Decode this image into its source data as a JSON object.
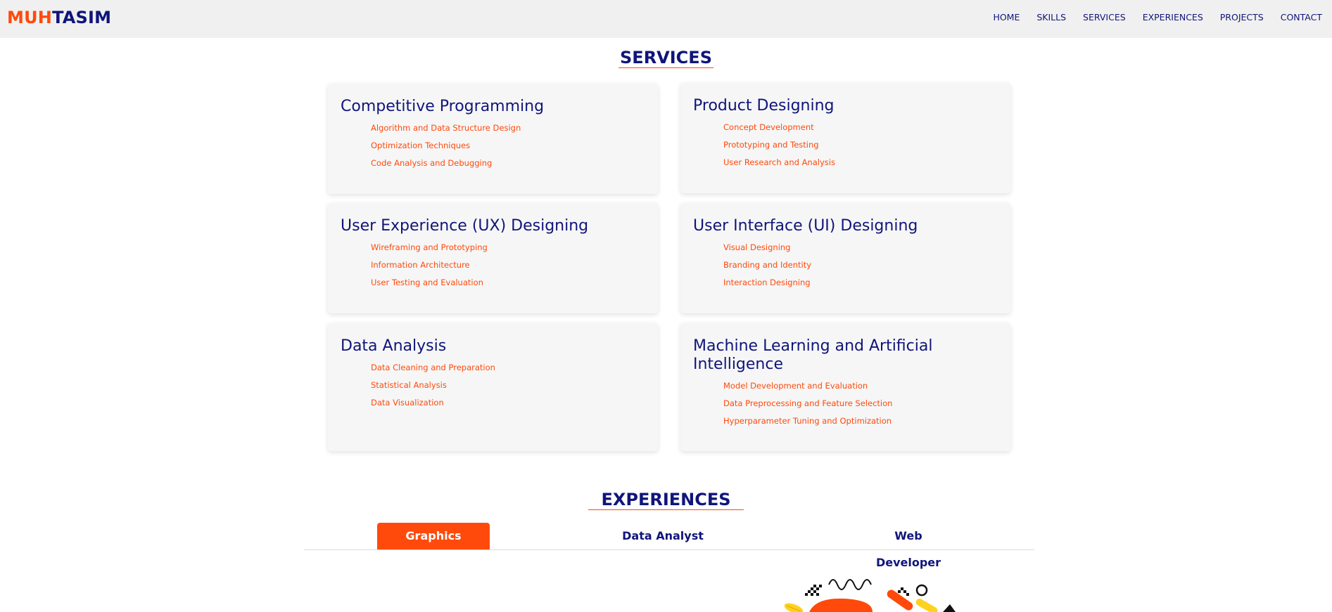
{
  "header": {
    "logo_part1": "MUH",
    "logo_part2": "TASIM",
    "nav": [
      "HOME",
      "SKILLS",
      "SERVICES",
      "EXPERIENCES",
      "PROJECTS",
      "CONTACT"
    ]
  },
  "services": {
    "title": "SERVICES",
    "cards": [
      {
        "title": "Competitive Programming",
        "items": [
          "Algorithm and Data Structure Design",
          "Optimization Techniques",
          "Code Analysis and Debugging"
        ]
      },
      {
        "title": "Product Designing",
        "items": [
          "Concept Development",
          "Prototyping and Testing",
          "User Research and Analysis"
        ]
      },
      {
        "title": "User Experience (UX) Designing",
        "items": [
          "Wireframing and Prototyping",
          "Information Architecture",
          "User Testing and Evaluation"
        ]
      },
      {
        "title": "User Interface (UI) Designing",
        "items": [
          "Visual Designing",
          "Branding and Identity",
          "Interaction Designing"
        ]
      },
      {
        "title": "Data Analysis",
        "items": [
          "Data Cleaning and Preparation",
          "Statistical Analysis",
          "Data Visualization"
        ]
      },
      {
        "title": "Machine Learning and Artificial Intelligence",
        "items": [
          "Model Development and Evaluation",
          "Data Preprocessing and Feature Selection",
          "Hyperparameter Tuning and Optimization"
        ]
      }
    ]
  },
  "experiences": {
    "title": "EXPERIENCES",
    "tabs": [
      "Graphics Designer",
      "Data Analyst",
      "Web Developer"
    ],
    "active_tab": "Graphics Designer"
  },
  "colors": {
    "accent": "#ff4a0b",
    "primary": "#10157a",
    "navbar_bg": "#f0f0f0",
    "card_bg": "#f6f6f6"
  }
}
